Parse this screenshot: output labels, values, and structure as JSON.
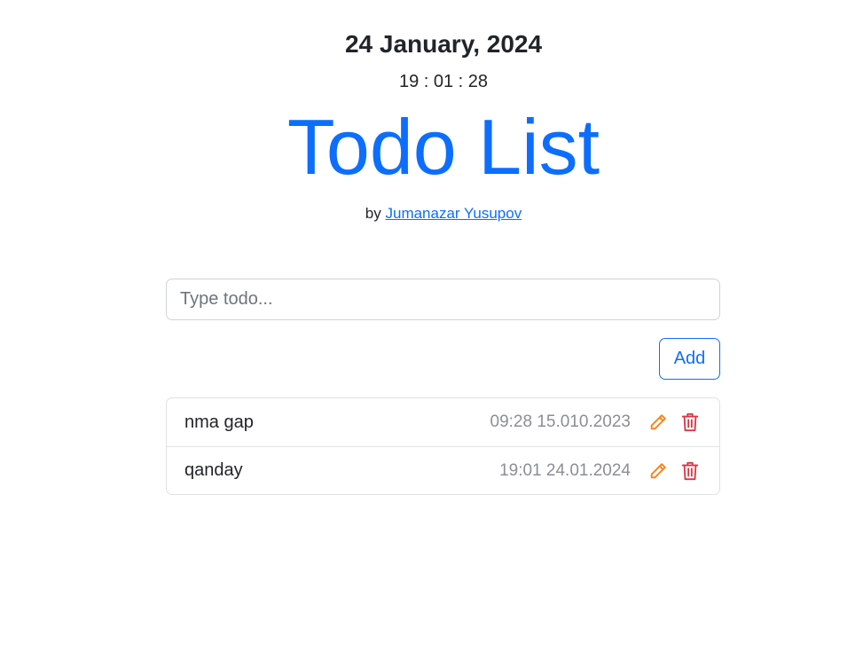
{
  "header": {
    "date": "24 January, 2024",
    "time": "19 : 01 : 28",
    "title": "Todo List",
    "by_prefix": "by",
    "author": "Jumanazar Yusupov"
  },
  "form": {
    "placeholder": "Type todo...",
    "value": "",
    "add_label": "Add"
  },
  "todos": [
    {
      "text": "nma gap",
      "time": "09:28 15.010.2023"
    },
    {
      "text": "qanday",
      "time": "19:01 24.01.2024"
    }
  ],
  "colors": {
    "primary": "#0d6efd",
    "edit": "#fd7e14",
    "delete": "#dc3545",
    "muted": "#8a8f94"
  },
  "icons": {
    "edit": "pencil-icon",
    "delete": "trash-icon"
  }
}
